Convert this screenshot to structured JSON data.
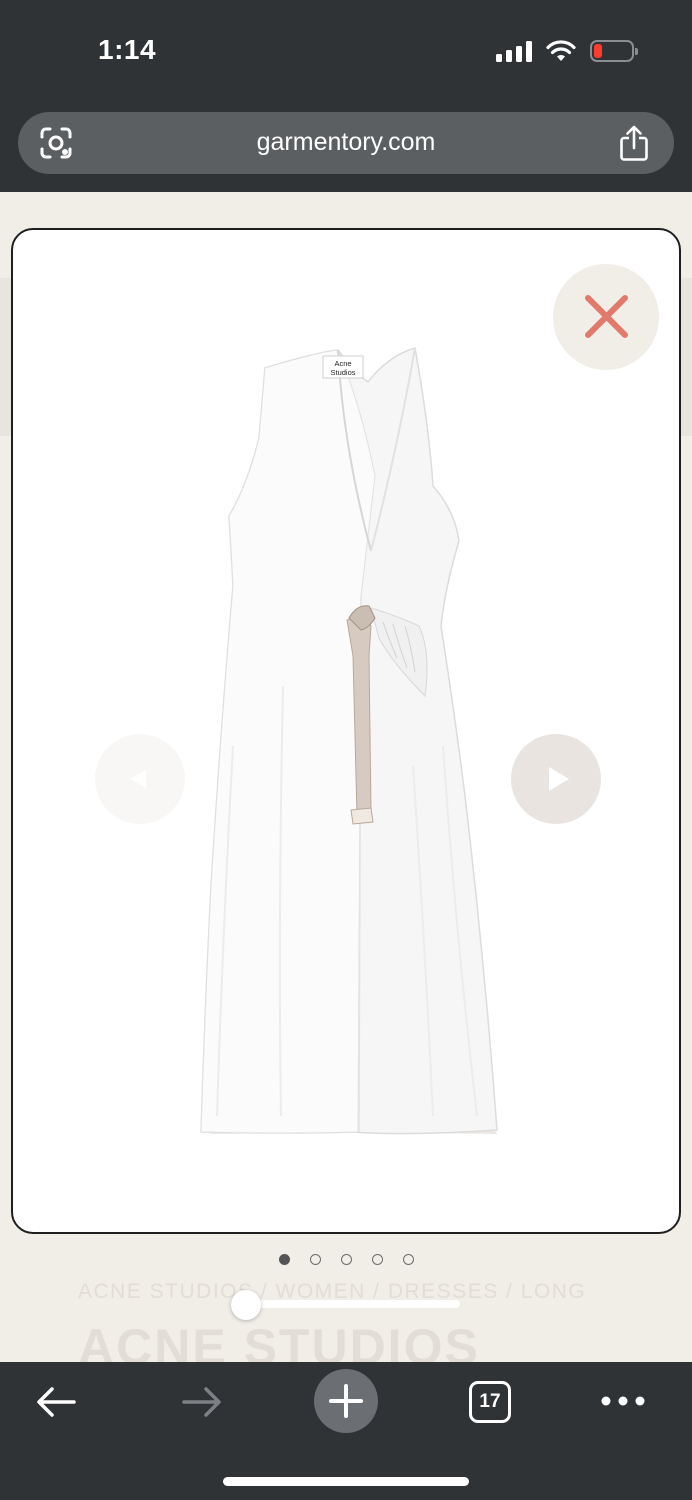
{
  "status_bar": {
    "time": "1:14",
    "icons": [
      "cellular-signal-icon",
      "wifi-icon",
      "battery-low-icon"
    ]
  },
  "browser": {
    "url": "garmentory.com",
    "lens_icon": "camera-lens-icon",
    "share_icon": "share-icon",
    "open_tabs_count": "17"
  },
  "gallery": {
    "image_description": "Acne Studios white sleeveless wrap midi dress with beige strap",
    "label_line1": "Acne",
    "label_line2": "Studios",
    "total_images": 5,
    "active_image_index": 0,
    "close_icon": "close-x-icon",
    "prev_icon": "arrow-left-icon",
    "next_icon": "arrow-right-icon"
  },
  "page": {
    "breadcrumb": "ACNE STUDIOS / WOMEN / DRESSES / LONG",
    "brand": "ACNE STUDIOS"
  },
  "colors": {
    "chrome": "#303336",
    "page_bg": "#f1eee8",
    "close_x": "#e27a6b",
    "next_button": "#e9e4df"
  }
}
